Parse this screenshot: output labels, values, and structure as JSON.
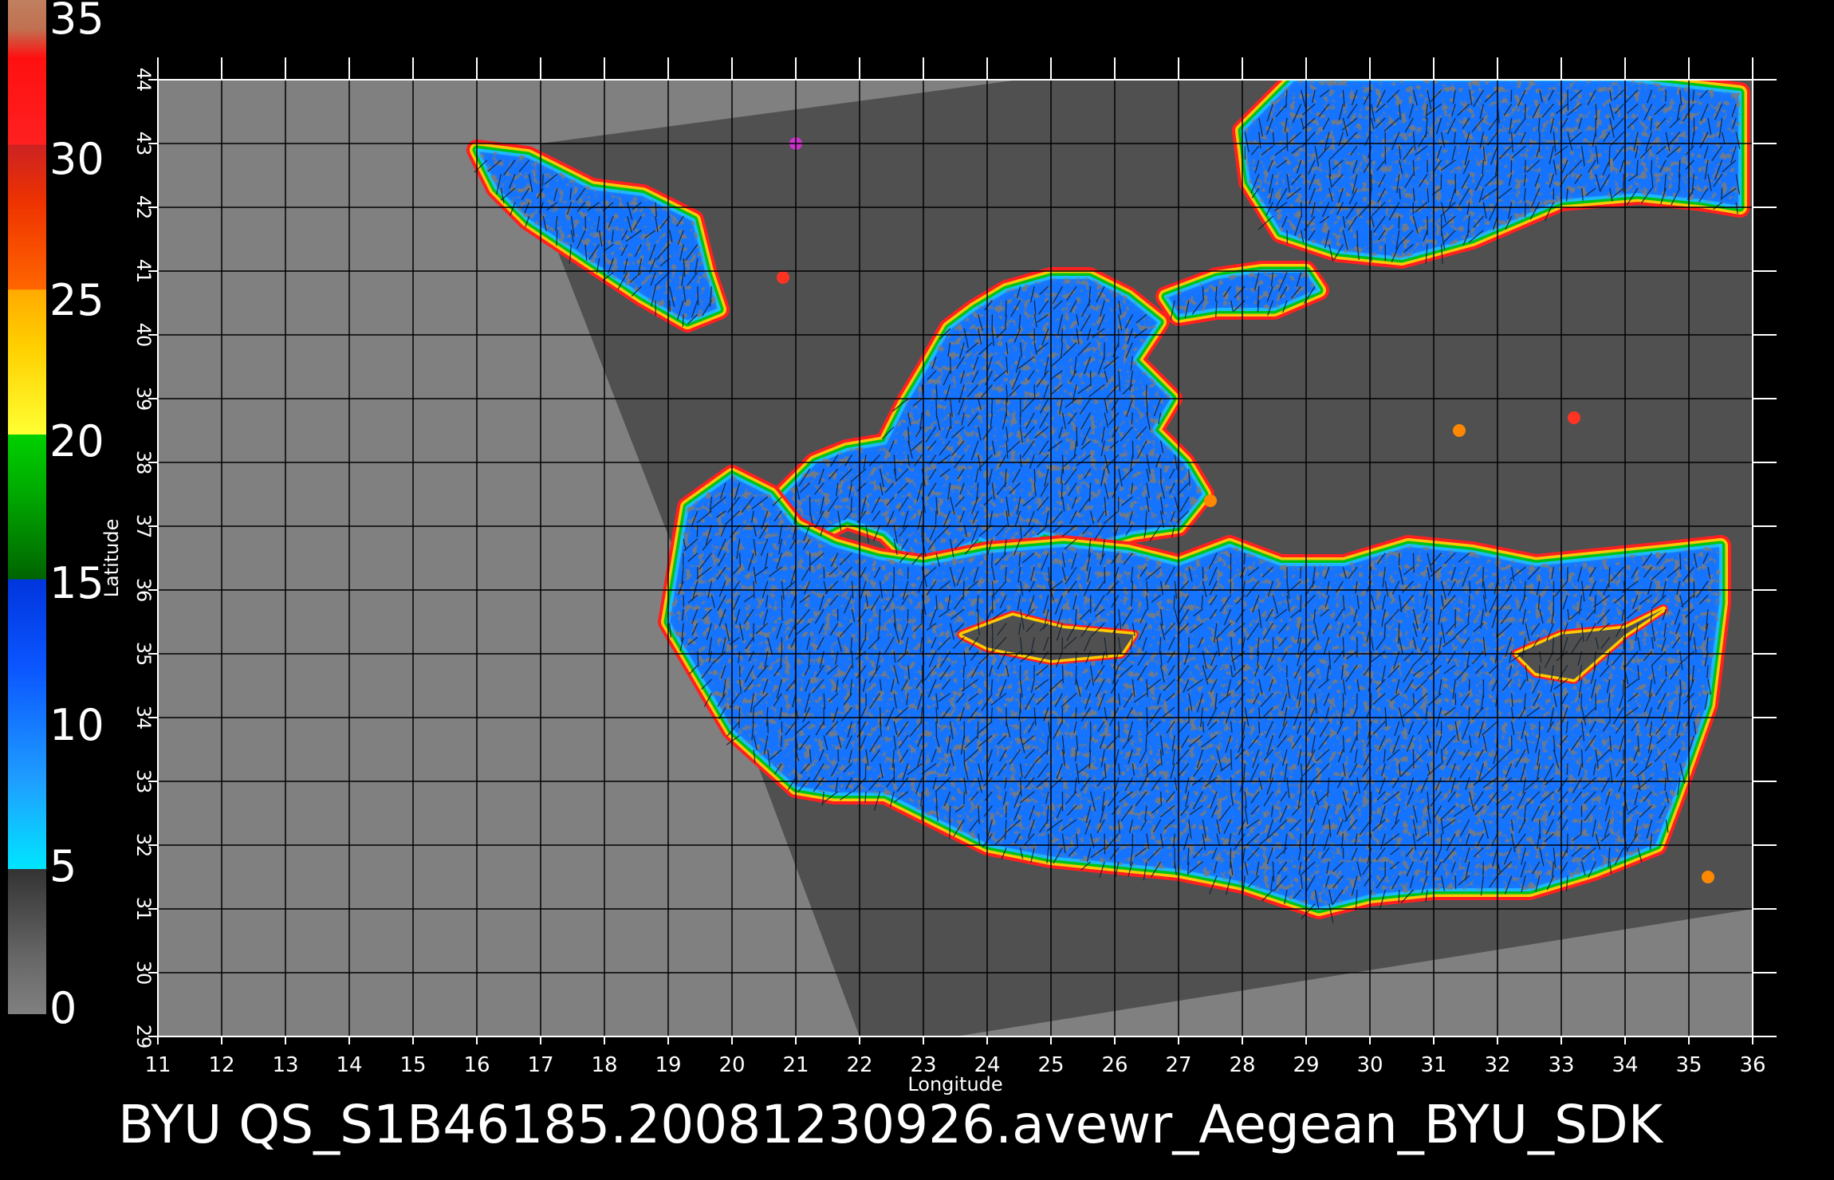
{
  "map": {
    "caption": "BYU  QS_S1B46185.20081230926.avewr_Aegean_BYU_SDK",
    "axis_x_title": "Longitude",
    "axis_y_title": "Latitude",
    "lon_range": [
      11,
      36
    ],
    "lat_range": [
      29,
      44
    ],
    "lon_ticks": [
      "11",
      "12",
      "13",
      "14",
      "15",
      "16",
      "17",
      "18",
      "19",
      "20",
      "21",
      "22",
      "23",
      "24",
      "25",
      "26",
      "27",
      "28",
      "29",
      "30",
      "31",
      "32",
      "33",
      "34",
      "35",
      "36"
    ],
    "lat_ticks": [
      "29",
      "30",
      "31",
      "32",
      "33",
      "34",
      "35",
      "36",
      "37",
      "38",
      "39",
      "40",
      "41",
      "42",
      "43",
      "44"
    ],
    "grid": "on",
    "colors": {
      "outside_swath": "#808080",
      "land": "#505050",
      "background": "#000000",
      "grid_lines": "#000000",
      "text": "#ffffff"
    }
  },
  "colorbar": {
    "ticks": [
      "35",
      "30",
      "25",
      "20",
      "15",
      "10",
      "5",
      "0"
    ],
    "tick_values": [
      35,
      30,
      25,
      20,
      15,
      10,
      5,
      0
    ],
    "range": [
      0,
      35
    ],
    "stops": [
      {
        "value": 0,
        "color": "#808080"
      },
      {
        "value": 2,
        "color": "#666666"
      },
      {
        "value": 5,
        "color": "#333333"
      },
      {
        "value": 5.01,
        "color": "#00e5ff"
      },
      {
        "value": 8,
        "color": "#1f9fff"
      },
      {
        "value": 12,
        "color": "#0b55ff"
      },
      {
        "value": 15,
        "color": "#0035dd"
      },
      {
        "value": 15.01,
        "color": "#006400"
      },
      {
        "value": 18,
        "color": "#00aa00"
      },
      {
        "value": 20,
        "color": "#00d000"
      },
      {
        "value": 20.01,
        "color": "#ffff33"
      },
      {
        "value": 23,
        "color": "#ffd000"
      },
      {
        "value": 25,
        "color": "#ffaa00"
      },
      {
        "value": 25.01,
        "color": "#ff6600"
      },
      {
        "value": 28,
        "color": "#ee3300"
      },
      {
        "value": 30,
        "color": "#cc2222"
      },
      {
        "value": 30.01,
        "color": "#ff2020"
      },
      {
        "value": 33,
        "color": "#ff1010"
      },
      {
        "value": 34,
        "color": "#c07050"
      },
      {
        "value": 35,
        "color": "#c08060"
      }
    ]
  },
  "ocean": {
    "aegean": [
      [
        20.5,
        37.2
      ],
      [
        21.2,
        36.8
      ],
      [
        21.8,
        37.1
      ],
      [
        22.4,
        36.9
      ],
      [
        22.8,
        36.5
      ],
      [
        23.4,
        36.6
      ],
      [
        23.9,
        36.8
      ],
      [
        24.3,
        36.6
      ],
      [
        24.9,
        36.9
      ],
      [
        25.6,
        36.7
      ],
      [
        26.3,
        36.9
      ],
      [
        27.0,
        37.0
      ],
      [
        27.4,
        37.5
      ],
      [
        27.1,
        38.0
      ],
      [
        26.6,
        38.5
      ],
      [
        26.9,
        39.0
      ],
      [
        26.3,
        39.6
      ],
      [
        26.7,
        40.2
      ],
      [
        26.2,
        40.6
      ],
      [
        25.6,
        40.9
      ],
      [
        25.0,
        40.9
      ],
      [
        24.3,
        40.7
      ],
      [
        23.8,
        40.4
      ],
      [
        23.4,
        40.1
      ],
      [
        23.0,
        39.4
      ],
      [
        22.7,
        38.9
      ],
      [
        22.4,
        38.3
      ],
      [
        21.8,
        38.2
      ],
      [
        21.3,
        38.0
      ],
      [
        20.9,
        37.6
      ]
    ],
    "adriatic": [
      [
        16.0,
        42.9
      ],
      [
        16.8,
        42.8
      ],
      [
        17.8,
        42.3
      ],
      [
        18.6,
        42.2
      ],
      [
        19.4,
        41.8
      ],
      [
        19.6,
        41.0
      ],
      [
        19.8,
        40.4
      ],
      [
        19.3,
        40.2
      ],
      [
        18.6,
        40.6
      ],
      [
        18.0,
        41.0
      ],
      [
        17.4,
        41.4
      ],
      [
        16.8,
        41.8
      ],
      [
        16.3,
        42.3
      ]
    ],
    "south": [
      [
        19.3,
        37.3
      ],
      [
        20.0,
        37.8
      ],
      [
        20.6,
        37.5
      ],
      [
        21.0,
        37.0
      ],
      [
        21.6,
        36.7
      ],
      [
        22.3,
        36.5
      ],
      [
        23.0,
        36.4
      ],
      [
        24.0,
        36.6
      ],
      [
        25.2,
        36.7
      ],
      [
        26.2,
        36.6
      ],
      [
        27.0,
        36.4
      ],
      [
        27.8,
        36.7
      ],
      [
        28.6,
        36.4
      ],
      [
        29.6,
        36.4
      ],
      [
        30.6,
        36.7
      ],
      [
        31.6,
        36.6
      ],
      [
        32.6,
        36.4
      ],
      [
        33.6,
        36.5
      ],
      [
        34.6,
        36.6
      ],
      [
        35.5,
        36.7
      ],
      [
        35.5,
        35.8
      ],
      [
        35.3,
        34.2
      ],
      [
        34.8,
        32.8
      ],
      [
        34.5,
        32.0
      ],
      [
        33.5,
        31.6
      ],
      [
        32.5,
        31.3
      ],
      [
        31.0,
        31.3
      ],
      [
        30.0,
        31.2
      ],
      [
        29.2,
        31.0
      ],
      [
        28.0,
        31.4
      ],
      [
        27.0,
        31.6
      ],
      [
        26.0,
        31.7
      ],
      [
        25.0,
        31.8
      ],
      [
        24.0,
        32.0
      ],
      [
        23.2,
        32.4
      ],
      [
        22.4,
        32.8
      ],
      [
        21.6,
        32.8
      ],
      [
        21.0,
        32.9
      ],
      [
        20.0,
        33.8
      ],
      [
        19.0,
        35.5
      ]
    ],
    "black_sea": [
      [
        28.0,
        43.2
      ],
      [
        28.8,
        44.0
      ],
      [
        30.5,
        44.0
      ],
      [
        32.5,
        44.0
      ],
      [
        34.0,
        44.0
      ],
      [
        35.8,
        43.8
      ],
      [
        35.8,
        42.0
      ],
      [
        35.2,
        42.1
      ],
      [
        34.2,
        42.2
      ],
      [
        33.0,
        42.1
      ],
      [
        31.6,
        41.5
      ],
      [
        30.5,
        41.2
      ],
      [
        29.5,
        41.3
      ],
      [
        28.6,
        41.6
      ],
      [
        28.1,
        42.4
      ]
    ],
    "marmara": [
      [
        26.8,
        40.6
      ],
      [
        27.6,
        40.9
      ],
      [
        28.3,
        41.0
      ],
      [
        29.0,
        41.0
      ],
      [
        29.2,
        40.7
      ],
      [
        28.5,
        40.4
      ],
      [
        27.6,
        40.4
      ],
      [
        27.0,
        40.3
      ]
    ]
  },
  "islands": {
    "crete": [
      [
        23.6,
        35.3
      ],
      [
        24.4,
        35.6
      ],
      [
        25.2,
        35.4
      ],
      [
        26.3,
        35.3
      ],
      [
        26.1,
        35.0
      ],
      [
        25.0,
        34.9
      ],
      [
        24.0,
        35.1
      ]
    ],
    "cyprus": [
      [
        32.3,
        35.0
      ],
      [
        33.0,
        35.3
      ],
      [
        34.0,
        35.4
      ],
      [
        34.6,
        35.7
      ],
      [
        34.0,
        35.3
      ],
      [
        33.2,
        34.6
      ],
      [
        32.6,
        34.7
      ]
    ]
  },
  "swath": {
    "polygon": [
      [
        17.0,
        43.0
      ],
      [
        24.5,
        44.0
      ],
      [
        36.0,
        44.0
      ],
      [
        36.0,
        31.0
      ],
      [
        23.5,
        29.0
      ],
      [
        22.0,
        29.0
      ],
      [
        20.5,
        33.0
      ],
      [
        17.0,
        42.0
      ]
    ]
  },
  "wind_vectors": {
    "seed": 46185,
    "mean_direction_deg": 200,
    "mean_speed": 9
  },
  "speck_patches": [
    [
      27.5,
      37.4,
      28.0
    ],
    [
      33.2,
      38.7,
      30.0
    ],
    [
      31.4,
      38.5,
      27.0
    ],
    [
      35.3,
      31.5,
      26.0
    ],
    [
      20.8,
      40.9,
      31.0
    ],
    [
      21.0,
      43.0,
      22.0
    ]
  ]
}
